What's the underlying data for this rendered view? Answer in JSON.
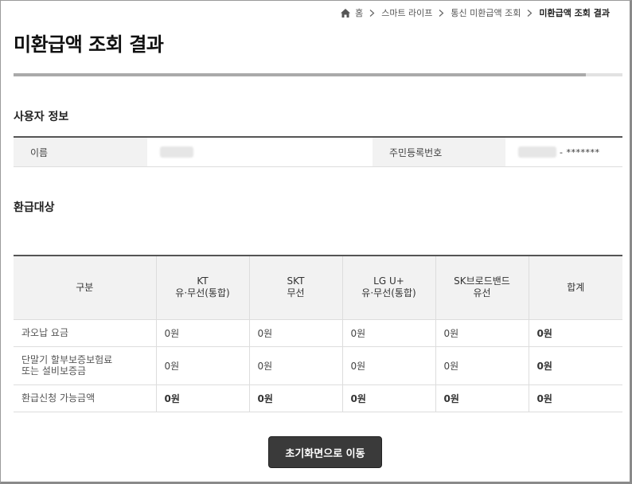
{
  "breadcrumb": {
    "items": [
      {
        "label": "홈"
      },
      {
        "label": "스마트 라이프"
      },
      {
        "label": "통신 미환급액 조회"
      },
      {
        "label": "미환급액 조회 결과"
      }
    ]
  },
  "page": {
    "title": "미환급액 조회 결과",
    "progress_fraction": 0.94
  },
  "user_info": {
    "section_title": "사용자 정보",
    "name_label": "이름",
    "rrn_label": "주민등록번호",
    "rrn_masked_suffix": "- *******"
  },
  "refund": {
    "section_title": "환급대상",
    "headers": {
      "category": "구분",
      "kt_line1": "KT",
      "kt_line2": "유·무선(통합)",
      "skt_line1": "SKT",
      "skt_line2": "무선",
      "lgu_line1": "LG U+",
      "lgu_line2": "유·무선(통합)",
      "skb_line1": "SK브로드밴드",
      "skb_line2": "유선",
      "total": "합계"
    },
    "rows": [
      {
        "label_line1": "과오납 요금",
        "label_line2": "",
        "kt": "0원",
        "skt": "0원",
        "lgu": "0원",
        "skb": "0원",
        "total": "0원"
      },
      {
        "label_line1": "단말기 할부보증보험료",
        "label_line2": "또는 설비보증금",
        "kt": "0원",
        "skt": "0원",
        "lgu": "0원",
        "skb": "0원",
        "total": "0원"
      },
      {
        "label_line1": "환급신청 가능금액",
        "label_line2": "",
        "kt": "0원",
        "skt": "0원",
        "lgu": "0원",
        "skb": "0원",
        "total": "0원"
      }
    ]
  },
  "actions": {
    "home_button_label": "초기화면으로 이동"
  },
  "colors": {
    "title": "#111111",
    "table_header_bg": "#f2f2f2",
    "table_top_border": "#555555",
    "button_bg": "#3a3a3a",
    "progress_fill": "#aaaaaa",
    "progress_track": "#e2e2e2"
  }
}
